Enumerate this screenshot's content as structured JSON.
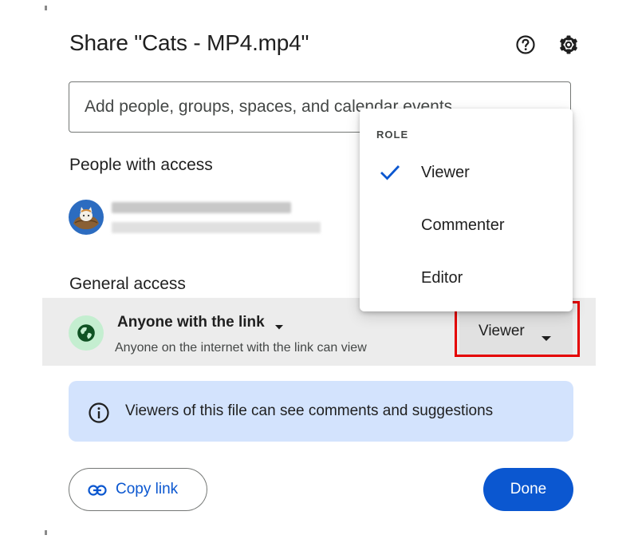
{
  "dialog": {
    "title": "Share \"Cats - MP4.mp4\"",
    "help_icon": "help-circle-icon",
    "settings_icon": "gear-icon"
  },
  "add_people": {
    "placeholder": "Add people, groups, spaces, and calendar events"
  },
  "people_with_access": {
    "heading": "People with access",
    "avatar_icon": "cat-avatar-icon"
  },
  "general_access": {
    "heading": "General access",
    "icon": "globe-icon",
    "icon_bg": "#c4eed0",
    "scope_label": "Anyone with the link",
    "description": "Anyone on the internet with the link can view",
    "role_label": "Viewer"
  },
  "role_menu": {
    "heading": "ROLE",
    "items": [
      {
        "label": "Viewer",
        "selected": true
      },
      {
        "label": "Commenter",
        "selected": false
      },
      {
        "label": "Editor",
        "selected": false
      }
    ]
  },
  "info_banner": {
    "icon": "info-icon",
    "text": "Viewers of this file can see comments and suggestions"
  },
  "footer": {
    "copy_link_label": "Copy link",
    "done_label": "Done"
  },
  "colors": {
    "accent": "#0b57d0",
    "banner": "#d3e3fd",
    "highlight": "#e50000"
  }
}
